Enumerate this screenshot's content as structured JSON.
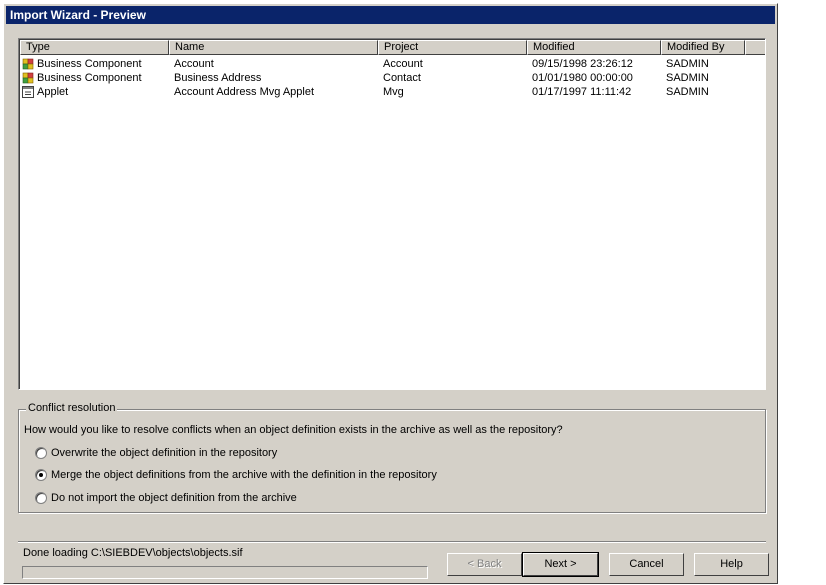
{
  "window": {
    "title": "Import Wizard - Preview"
  },
  "list": {
    "columns": [
      "Type",
      "Name",
      "Project",
      "Modified",
      "Modified By"
    ],
    "rows": [
      {
        "icon": "business-component-icon",
        "type": "Business Component",
        "name": "Account",
        "project": "Account",
        "modified": "09/15/1998 23:26:12",
        "modified_by": "SADMIN"
      },
      {
        "icon": "business-component-icon",
        "type": "Business Component",
        "name": "Business Address",
        "project": "Contact",
        "modified": "01/01/1980 00:00:00",
        "modified_by": "SADMIN"
      },
      {
        "icon": "applet-icon",
        "type": "Applet",
        "name": "Account Address Mvg Applet",
        "project": "Mvg",
        "modified": "01/17/1997 11:11:42",
        "modified_by": "SADMIN"
      }
    ]
  },
  "conflict": {
    "legend": "Conflict resolution",
    "question": "How would you like to resolve conflicts when an object definition exists in the archive as well as the repository?",
    "options": [
      {
        "label": "Overwrite the object definition in the repository",
        "selected": false
      },
      {
        "label": "Merge the object definitions from the archive with the definition in the repository",
        "selected": true
      },
      {
        "label": "Do not import the object definition from the archive",
        "selected": false
      }
    ]
  },
  "status": {
    "text": "Done loading C:\\SIEBDEV\\objects\\objects.sif",
    "progress": 0
  },
  "buttons": {
    "back": "< Back",
    "next": "Next >",
    "cancel": "Cancel",
    "help": "Help"
  }
}
